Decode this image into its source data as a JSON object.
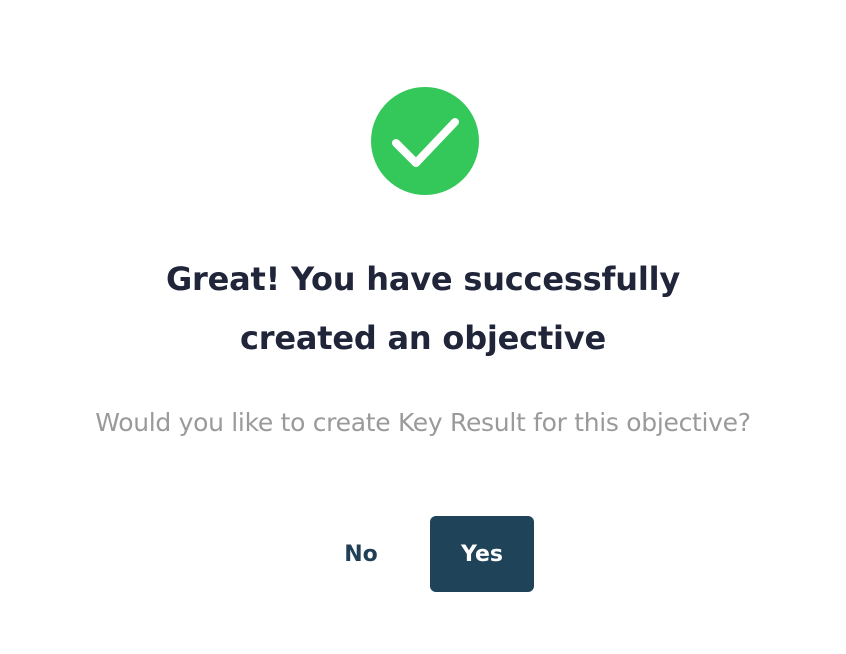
{
  "dialog": {
    "icon": "check-circle-icon",
    "title_line1": "Great! You have successfully",
    "title_line2": "created an objective",
    "subtitle": "Would you like to create Key Result for this objective?",
    "no_label": "No",
    "yes_label": "Yes"
  },
  "colors": {
    "success": "#34c759",
    "primary": "#1f4359",
    "title_text": "#20253a",
    "muted_text": "#9a9a9a"
  }
}
